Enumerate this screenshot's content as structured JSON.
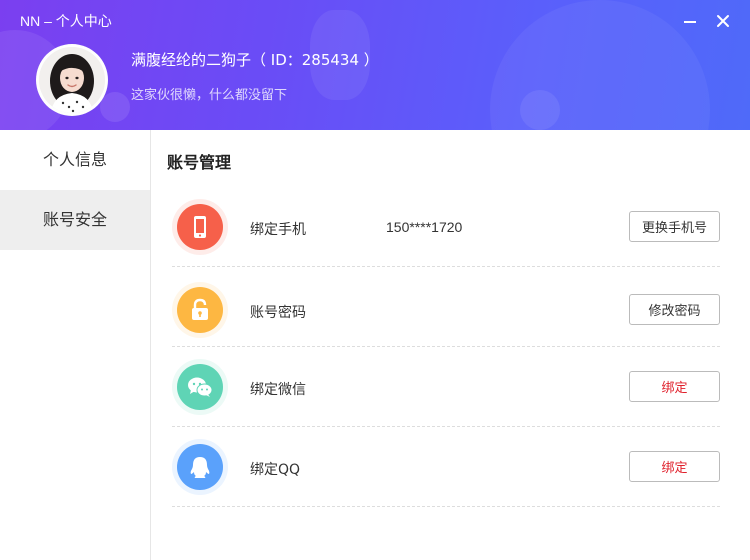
{
  "window": {
    "title": "NN – 个人中心"
  },
  "user": {
    "name_line": "满腹经纶的二狗子（ ID：285434 ）",
    "signature": "这家伙很懒，什么都没留下"
  },
  "sidebar": {
    "items": [
      {
        "label": "个人信息",
        "active": false
      },
      {
        "label": "账号安全",
        "active": true
      }
    ]
  },
  "main": {
    "title": "账号管理",
    "rows": [
      {
        "icon": "phone-icon",
        "color": "#f6604a",
        "label": "绑定手机",
        "value": "150****1720",
        "button": "更换手机号"
      },
      {
        "icon": "lock-icon",
        "color": "#fdb843",
        "label": "账号密码",
        "value": "",
        "button": "修改密码"
      },
      {
        "icon": "wechat-icon",
        "color": "#5fd4b6",
        "label": "绑定微信",
        "value": "",
        "button": "绑定"
      },
      {
        "icon": "qq-icon",
        "color": "#5aa1fb",
        "label": "绑定QQ",
        "value": "",
        "button": "绑定"
      }
    ]
  },
  "colors": {
    "header_gradient_start": "#7b3ff0",
    "header_gradient_end": "#4f6af9",
    "bind_text": "#e0202b",
    "active_sidebar_bg": "#eeeeee"
  }
}
